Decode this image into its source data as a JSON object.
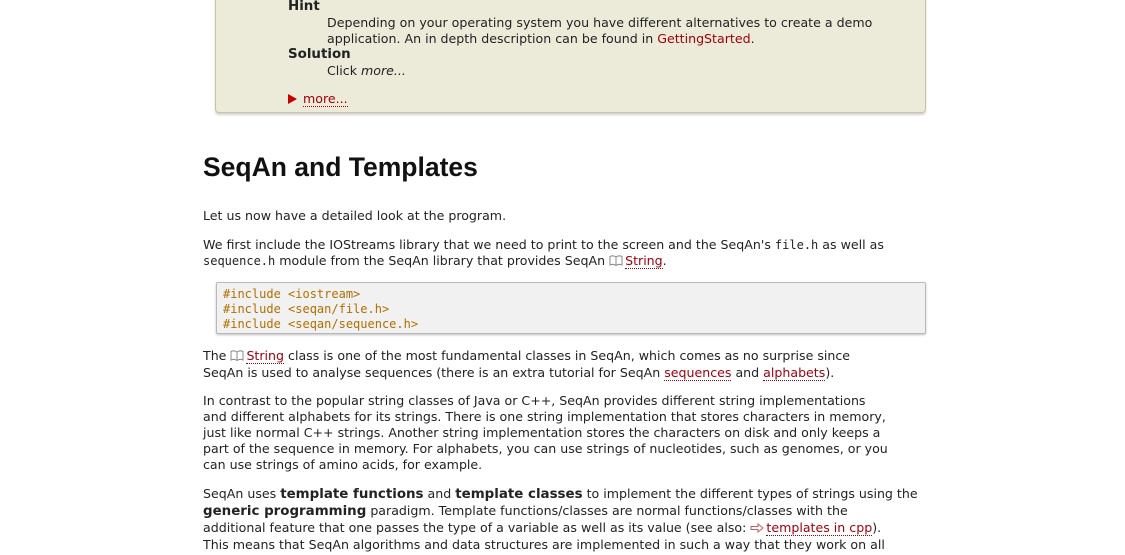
{
  "task_box": {
    "hint_label": "Hint",
    "hint_text_1": "Depending on your operating system you have different alternatives to create a demo",
    "hint_text_2_pre": "application. An in depth description can be found in ",
    "hint_link": "GettingStarted",
    "hint_text_2_post": ".",
    "solution_label": "Solution",
    "solution_pre": "Click ",
    "solution_more": "more...",
    "more_toggle": "more..."
  },
  "heading": "SeqAn and Templates",
  "p1": "Let us now have a detailed look at the program.",
  "p2": {
    "t1": "We first include the IOStreams library that we need to print to the screen and the SeqAn's ",
    "code1": "file.h",
    "t2": " as well as",
    "code2": "sequence.h",
    "t3": " module from the SeqAn library that provides SeqAn ",
    "link": "String",
    "t4": "."
  },
  "code_lines": [
    "#include <iostream>",
    "#include <seqan/file.h>",
    "#include <seqan/sequence.h>"
  ],
  "p3": {
    "t1": "The ",
    "link": "String",
    "t2": " class is one of the most fundamental classes in SeqAn, which comes as no surprise since",
    "t3": "SeqAn is used to analyse sequences (there is an extra tutorial for SeqAn ",
    "link_seq": "sequences",
    "t4": " and ",
    "link_alpha": "alphabets",
    "t5": ")."
  },
  "p4": [
    "In contrast to the popular string classes of Java or C++, SeqAn provides different string implementations",
    "and different alphabets for its strings. There is one string implementation that stores characters in memory,",
    "just like normal C++ strings. Another string implementation stores the characters on disk and only keeps a",
    "part of the sequence in memory. For alphabets, you can use strings of nucleotides, such as genomes, or you",
    "can use strings of amino acids, for example."
  ],
  "p5": {
    "t1": "SeqAn uses ",
    "b1": "template functions",
    "t2": " and ",
    "b2": "template classes",
    "t3": " to implement the different types of strings using the",
    "b3": "generic programming",
    "t4": " paradigm. Template functions/classes are normal functions/classes with the",
    "t5": "additional feature that one passes the type of a variable as well as its value (see also: ",
    "link": "templates in cpp",
    "t6": ").",
    "t7": "This means that SeqAn algorithms and data structures are implemented in such a way that they work on all"
  }
}
